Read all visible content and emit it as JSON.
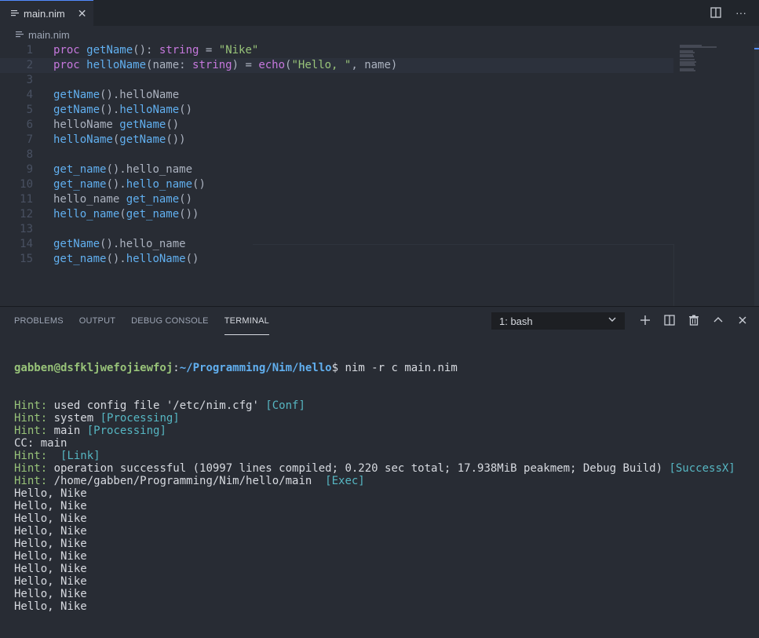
{
  "tab": {
    "label": "main.nim"
  },
  "breadcrumb": {
    "file": "main.nim"
  },
  "editor": {
    "lines": [
      {
        "n": "1",
        "tokens": [
          [
            "kw",
            "proc "
          ],
          [
            "fn",
            "getName"
          ],
          [
            "tx",
            "(): "
          ],
          [
            "kw",
            "string"
          ],
          [
            "tx",
            " = "
          ],
          [
            "str",
            "\"Nike\""
          ]
        ]
      },
      {
        "n": "2",
        "tokens": [
          [
            "kw",
            "proc "
          ],
          [
            "fn",
            "helloName"
          ],
          [
            "tx",
            "(name: "
          ],
          [
            "kw",
            "string"
          ],
          [
            "tx",
            ") = "
          ],
          [
            "kw",
            "echo"
          ],
          [
            "tx",
            "("
          ],
          [
            "str",
            "\"Hello, \""
          ],
          [
            "tx",
            ", name)"
          ]
        ]
      },
      {
        "n": "3",
        "tokens": []
      },
      {
        "n": "4",
        "tokens": [
          [
            "fn",
            "getName"
          ],
          [
            "tx",
            "().helloName"
          ]
        ]
      },
      {
        "n": "5",
        "tokens": [
          [
            "fn",
            "getName"
          ],
          [
            "tx",
            "()."
          ],
          [
            "fn",
            "helloName"
          ],
          [
            "tx",
            "()"
          ]
        ]
      },
      {
        "n": "6",
        "tokens": [
          [
            "tx",
            "helloName "
          ],
          [
            "fn",
            "getName"
          ],
          [
            "tx",
            "()"
          ]
        ]
      },
      {
        "n": "7",
        "tokens": [
          [
            "fn",
            "helloName"
          ],
          [
            "tx",
            "("
          ],
          [
            "fn",
            "getName"
          ],
          [
            "tx",
            "())"
          ]
        ]
      },
      {
        "n": "8",
        "tokens": []
      },
      {
        "n": "9",
        "tokens": [
          [
            "fn",
            "get_name"
          ],
          [
            "tx",
            "().hello_name"
          ]
        ]
      },
      {
        "n": "10",
        "tokens": [
          [
            "fn",
            "get_name"
          ],
          [
            "tx",
            "()."
          ],
          [
            "fn",
            "hello_name"
          ],
          [
            "tx",
            "()"
          ]
        ]
      },
      {
        "n": "11",
        "tokens": [
          [
            "tx",
            "hello_name "
          ],
          [
            "fn",
            "get_name"
          ],
          [
            "tx",
            "()"
          ]
        ]
      },
      {
        "n": "12",
        "tokens": [
          [
            "fn",
            "hello_name"
          ],
          [
            "tx",
            "("
          ],
          [
            "fn",
            "get_name"
          ],
          [
            "tx",
            "())"
          ]
        ]
      },
      {
        "n": "13",
        "tokens": []
      },
      {
        "n": "14",
        "tokens": [
          [
            "fn",
            "getName"
          ],
          [
            "tx",
            "().hello_name"
          ]
        ]
      },
      {
        "n": "15",
        "tokens": [
          [
            "fn",
            "get_name"
          ],
          [
            "tx",
            "()."
          ],
          [
            "fn",
            "helloName"
          ],
          [
            "tx",
            "()"
          ]
        ]
      }
    ]
  },
  "panel": {
    "tabs": [
      "PROBLEMS",
      "OUTPUT",
      "DEBUG CONSOLE",
      "TERMINAL"
    ],
    "active_tab": "TERMINAL",
    "terminal_select": "1: bash"
  },
  "terminal": {
    "prompt_user": "gabben@dsfkljwefojiewfoj",
    "prompt_path": "~/Programming/Nim/hello",
    "command": "$ nim -r c main.nim",
    "lines": [
      [
        [
          "t-hint",
          "Hint: "
        ],
        [
          "t-plain",
          "used config file '/etc/nim.cfg' "
        ],
        [
          "t-tag",
          "[Conf]"
        ]
      ],
      [
        [
          "t-hint",
          "Hint: "
        ],
        [
          "t-plain",
          "system "
        ],
        [
          "t-tag",
          "[Processing]"
        ]
      ],
      [
        [
          "t-hint",
          "Hint: "
        ],
        [
          "t-plain",
          "main "
        ],
        [
          "t-tag",
          "[Processing]"
        ]
      ],
      [
        [
          "t-plain",
          "CC: main"
        ]
      ],
      [
        [
          "t-hint",
          "Hint: "
        ],
        [
          "t-plain",
          " "
        ],
        [
          "t-tag",
          "[Link]"
        ]
      ],
      [
        [
          "t-hint",
          "Hint: "
        ],
        [
          "t-plain",
          "operation successful (10997 lines compiled; 0.220 sec total; 17.938MiB peakmem; Debug Build) "
        ],
        [
          "t-tag",
          "[SuccessX]"
        ]
      ],
      [
        [
          "t-hint",
          "Hint: "
        ],
        [
          "t-plain",
          "/home/gabben/Programming/Nim/hello/main  "
        ],
        [
          "t-tag",
          "[Exec]"
        ]
      ],
      [
        [
          "t-plain",
          "Hello, Nike"
        ]
      ],
      [
        [
          "t-plain",
          "Hello, Nike"
        ]
      ],
      [
        [
          "t-plain",
          "Hello, Nike"
        ]
      ],
      [
        [
          "t-plain",
          "Hello, Nike"
        ]
      ],
      [
        [
          "t-plain",
          "Hello, Nike"
        ]
      ],
      [
        [
          "t-plain",
          "Hello, Nike"
        ]
      ],
      [
        [
          "t-plain",
          "Hello, Nike"
        ]
      ],
      [
        [
          "t-plain",
          "Hello, Nike"
        ]
      ],
      [
        [
          "t-plain",
          "Hello, Nike"
        ]
      ],
      [
        [
          "t-plain",
          "Hello, Nike"
        ]
      ]
    ]
  },
  "colors": {
    "background": "#282c34",
    "keyword": "#c678dd",
    "function": "#61afef",
    "string": "#98c379",
    "accent": "#528bff"
  }
}
